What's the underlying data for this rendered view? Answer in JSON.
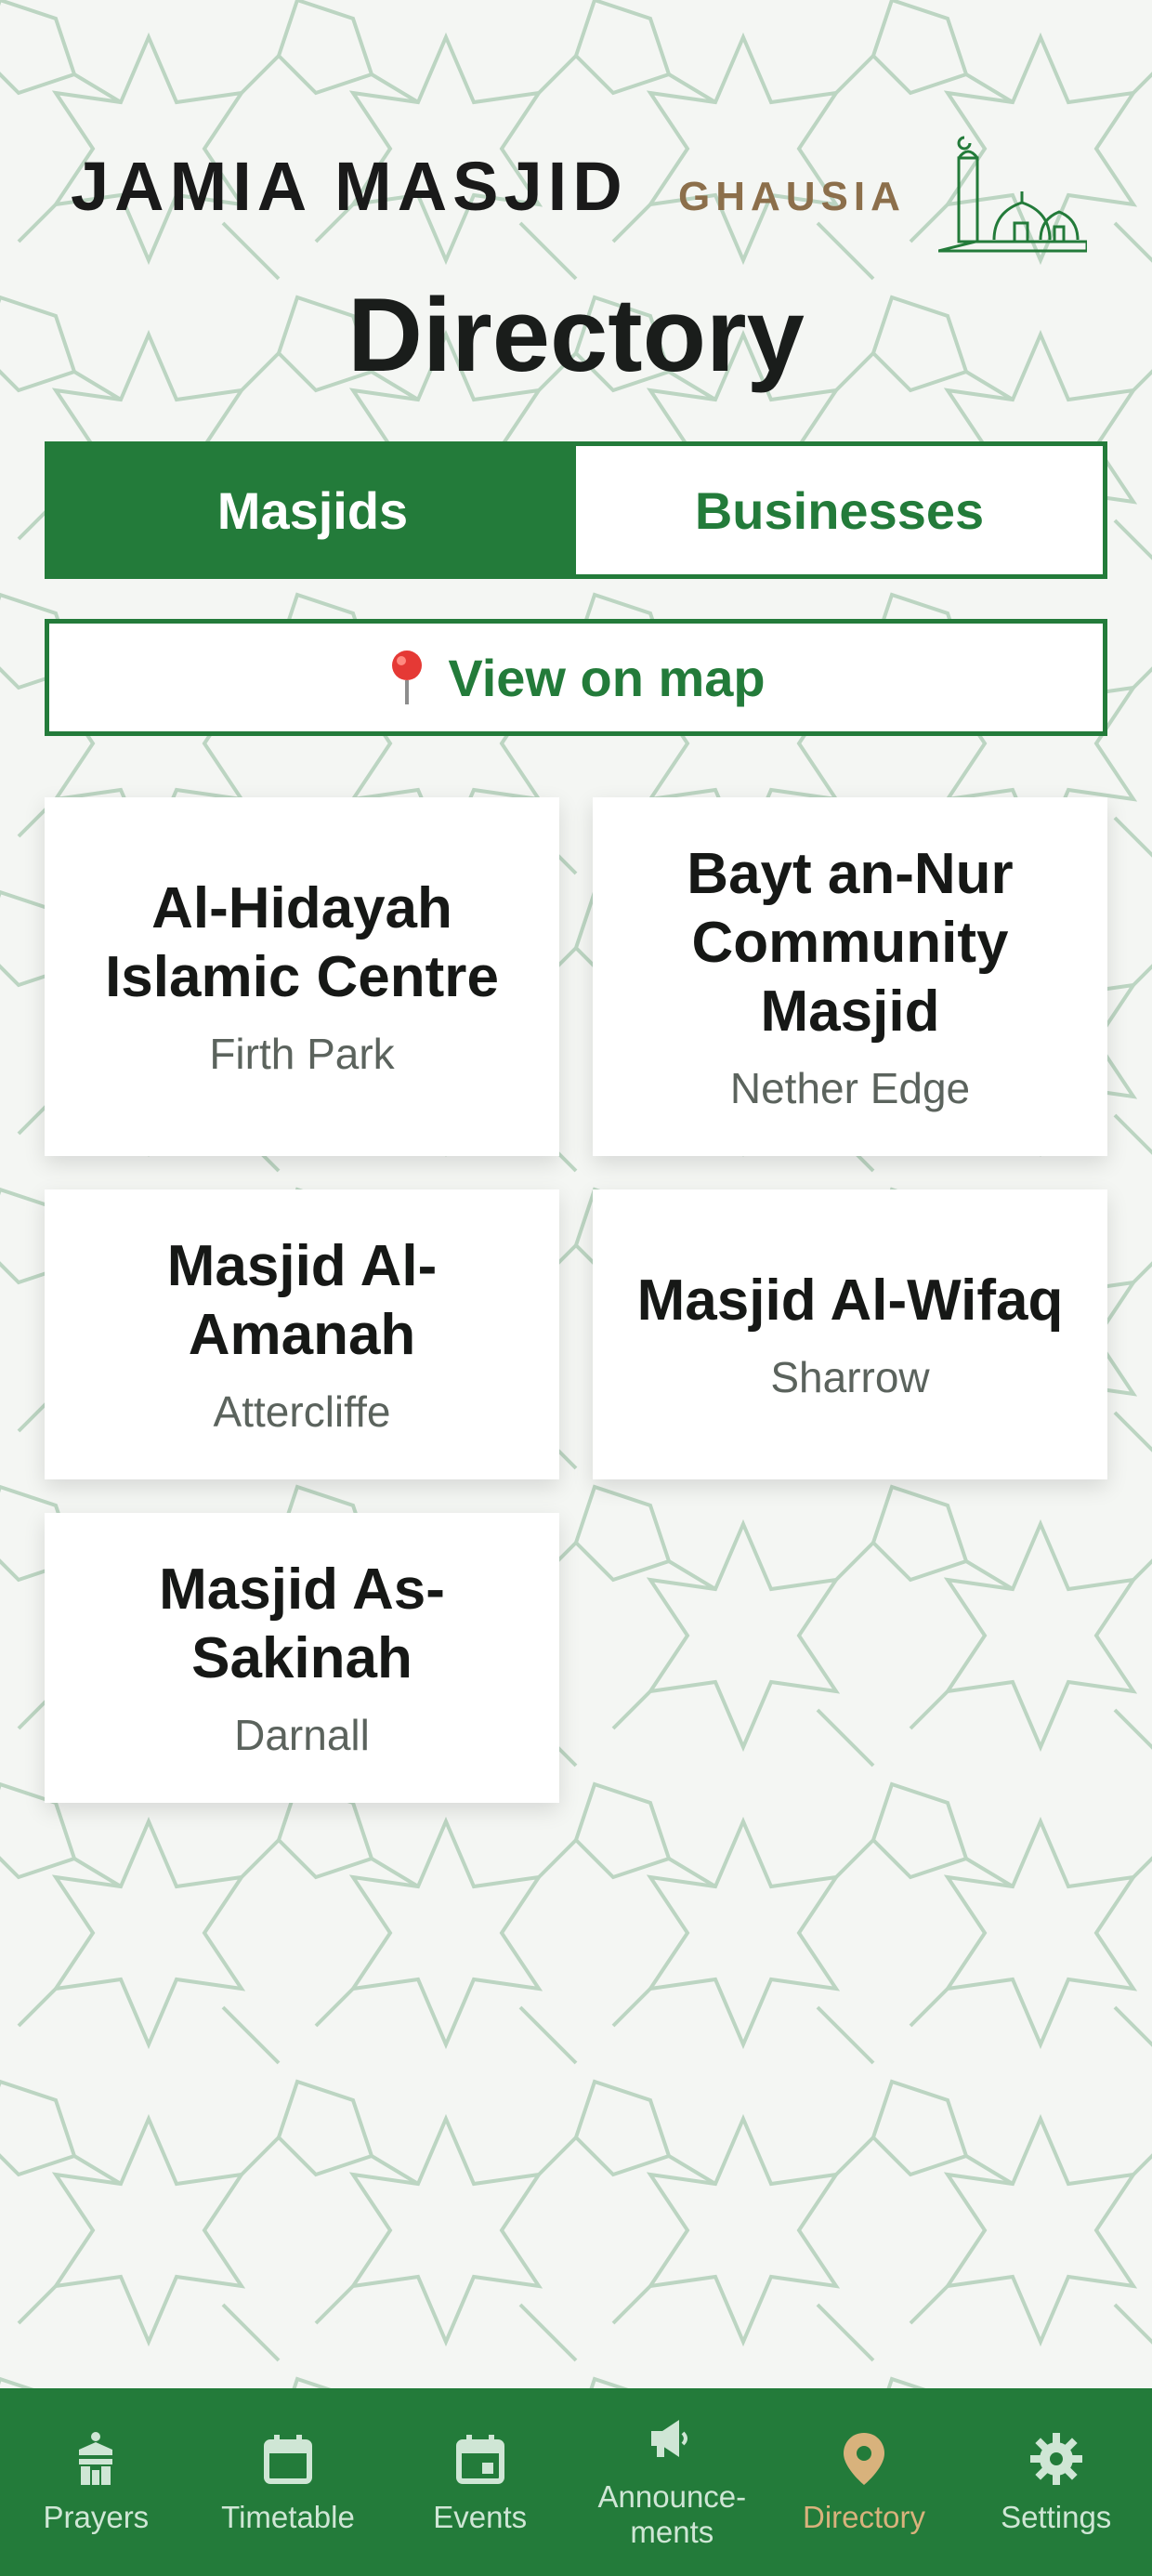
{
  "status_bar": {
    "left": "",
    "right": ""
  },
  "header": {
    "logo_main": "JAMIA MASJID",
    "logo_sub": "GHAUSIA",
    "title": "Directory"
  },
  "tabs": [
    {
      "label": "Masjids",
      "active": true
    },
    {
      "label": "Businesses",
      "active": false
    }
  ],
  "map_button": {
    "label": "View on map",
    "icon": "map-pin-icon"
  },
  "masjids": [
    {
      "name": "Al-Hidayah Islamic Centre",
      "area": "Firth Park"
    },
    {
      "name": "Bayt an-Nur Community Masjid",
      "area": "Nether Edge"
    },
    {
      "name": "Masjid Al-Amanah",
      "area": "Attercliffe"
    },
    {
      "name": "Masjid Al-Wifaq",
      "area": "Sharrow"
    },
    {
      "name": "Masjid As-Sakinah",
      "area": "Darnall"
    }
  ],
  "bottom_nav": [
    {
      "label": "Prayers",
      "icon": "prayer-icon",
      "active": false
    },
    {
      "label": "Timetable",
      "icon": "calendar-icon",
      "active": false
    },
    {
      "label": "Events",
      "icon": "event-icon",
      "active": false
    },
    {
      "label": "Announce-\nments",
      "icon": "megaphone-icon",
      "active": false
    },
    {
      "label": "Directory",
      "icon": "location-pin-icon",
      "active": true
    },
    {
      "label": "Settings",
      "icon": "gear-icon",
      "active": false
    }
  ],
  "colors": {
    "primary_green": "#237b3a",
    "accent_gold": "#d8b27c",
    "logo_brown": "#8c6f4b",
    "pattern_green": "#bcd5c2"
  }
}
